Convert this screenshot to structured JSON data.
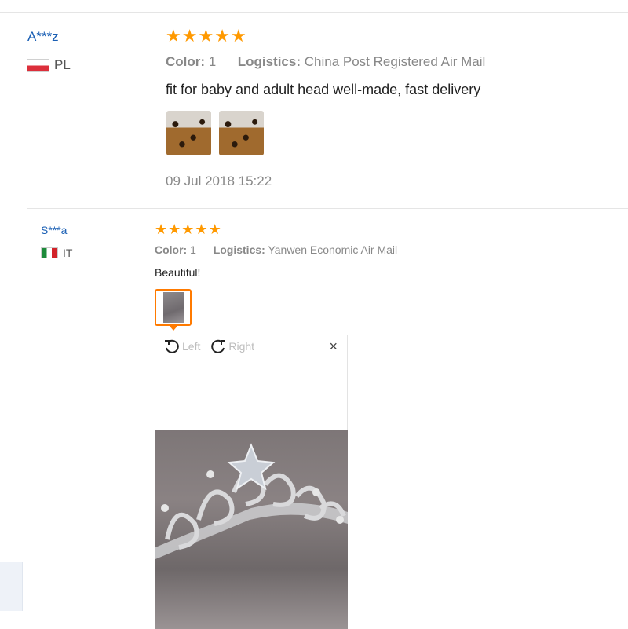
{
  "reviews": [
    {
      "user": "A***z",
      "country": "PL",
      "rating": 5,
      "color_label": "Color:",
      "color_value": "1",
      "logistics_label": "Logistics:",
      "logistics_value": "China Post Registered Air Mail",
      "text": "fit for baby and adult head well-made, fast delivery",
      "photo_count": 2,
      "date": "09 Jul 2018 15:22"
    },
    {
      "user": "S***a",
      "country": "IT",
      "rating": 5,
      "color_label": "Color:",
      "color_value": "1",
      "logistics_label": "Logistics:",
      "logistics_value": "Yanwen Economic Air Mail",
      "text": "Beautiful!",
      "photo_count": 1
    }
  ],
  "viewer": {
    "rotate_left_label": "Left",
    "rotate_right_label": "Right",
    "close_icon": "×"
  },
  "icons": {
    "star": "★",
    "rotate_left": "rotate-left-icon",
    "rotate_right": "rotate-right-icon"
  },
  "colors": {
    "star": "#ff9900",
    "user_link": "#1a5fb4",
    "active_thumb_border": "#ff7a00"
  }
}
